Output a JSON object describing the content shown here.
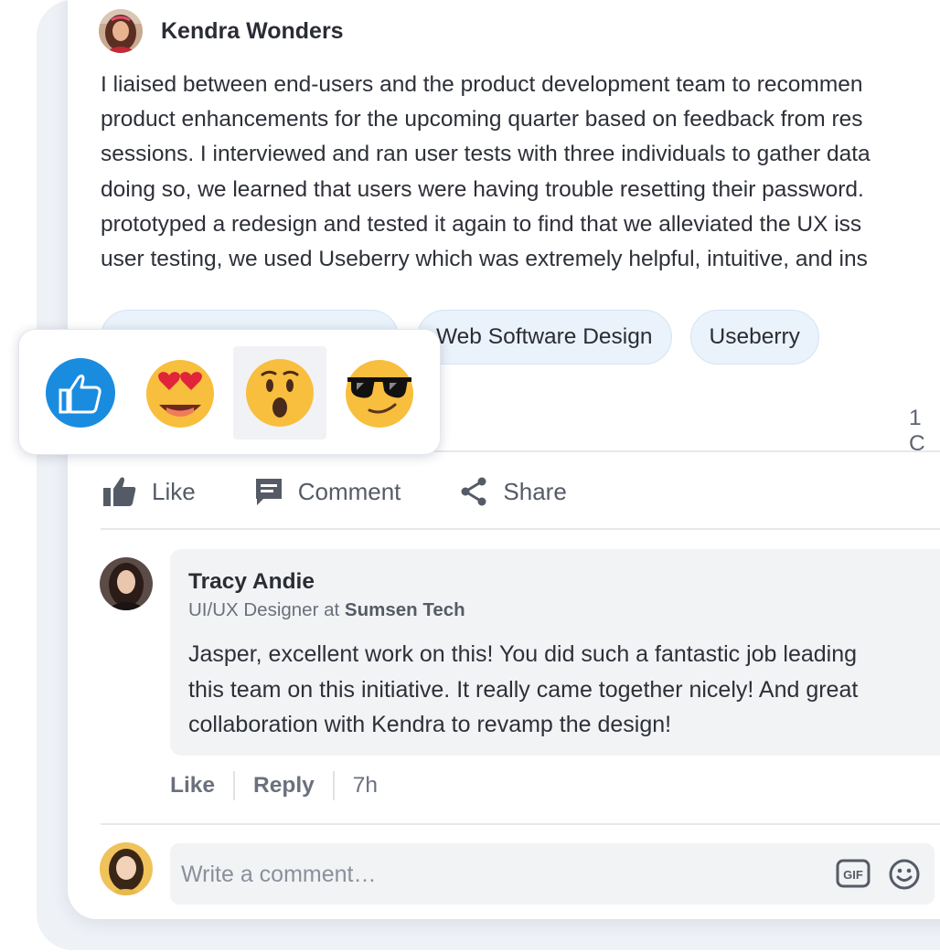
{
  "post": {
    "author_name": "Kendra Wonders",
    "body_lines": [
      "I liaised between end-users and the product development team to recommen",
      "product enhancements for the upcoming quarter based on feedback from res",
      "sessions. I interviewed and ran user tests with three individuals to gather data",
      "doing so, we learned that users were having trouble resetting their password.",
      "prototyped a redesign and tested it again to find that we alleviated the UX iss",
      "user testing, we used Useberry which was extremely helpful, intuitive, and ins"
    ],
    "tags": [
      "",
      "Web Software Design",
      "Useberry"
    ],
    "comment_count_text": "1 C"
  },
  "actions": {
    "like_label": "Like",
    "comment_label": "Comment",
    "share_label": "Share"
  },
  "reactions": {
    "items": [
      "like-icon",
      "heart-eyes-icon",
      "surprised-icon",
      "sunglasses-icon"
    ],
    "hovered": "surprised-icon",
    "like_color": "#1a8ce0"
  },
  "comment": {
    "author_name": "Tracy Andie",
    "role_prefix": "UI/UX Designer at",
    "company": "Sumsen Tech",
    "text_lines": [
      "Jasper, excellent work on this! You did such a fantastic job leading",
      "this team on this initiative. It really came together nicely! And great",
      "collaboration with Kendra to revamp the design!"
    ],
    "like_label": "Like",
    "reply_label": "Reply",
    "time": "7h"
  },
  "composer": {
    "placeholder": "Write a comment…",
    "gif_label": "GIF"
  }
}
